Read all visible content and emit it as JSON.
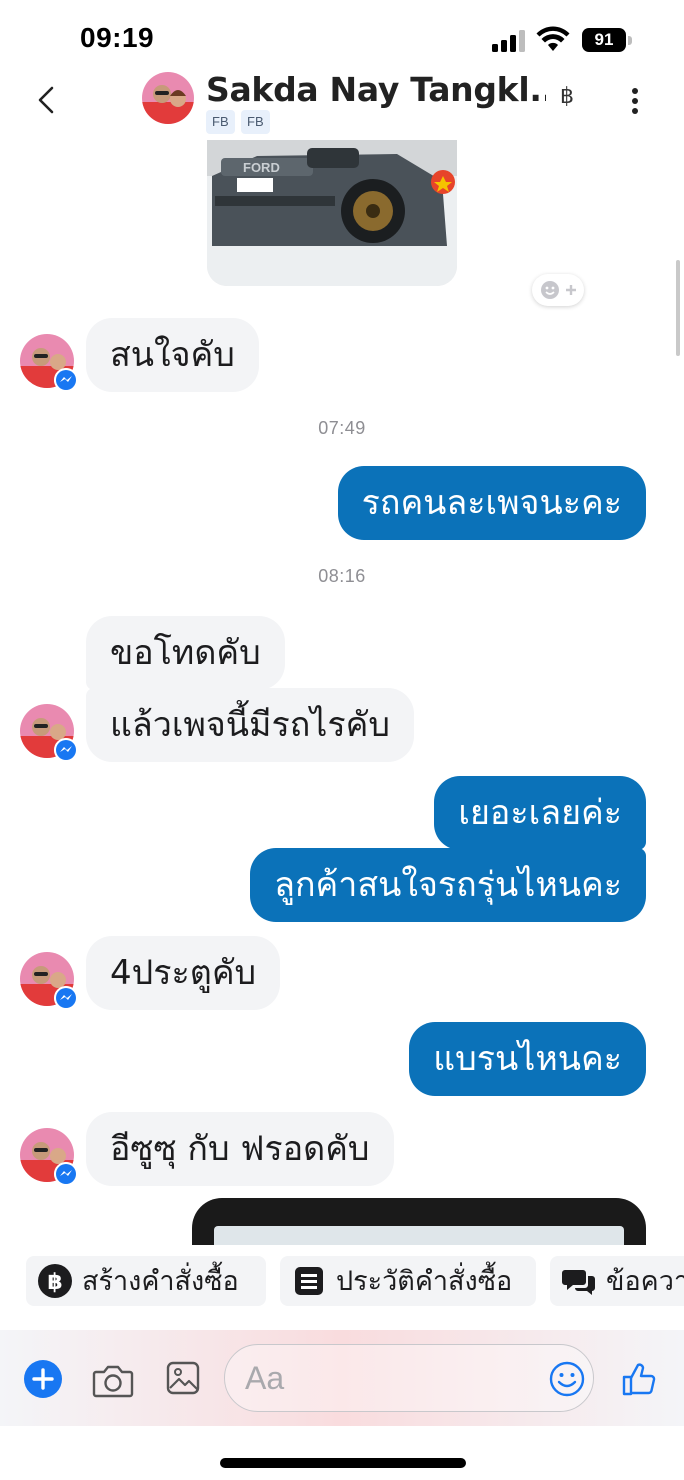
{
  "status_bar": {
    "time": "09:19",
    "battery": "91",
    "icons": [
      "cellular-signal-icon",
      "wifi-icon",
      "battery-icon"
    ]
  },
  "header": {
    "contact_name": "Sakda Nay Tangkl...",
    "source_badges": [
      "FB",
      "FB"
    ],
    "currency_symbol": "฿",
    "icons": [
      "back-chevron-icon",
      "baht-icon",
      "more-vertical-icon"
    ]
  },
  "messages": [
    {
      "type": "image",
      "from": "contact",
      "description": "car-photo"
    },
    {
      "from": "contact",
      "text": "สนใจคับ"
    },
    {
      "type": "timestamp",
      "text": "07:49"
    },
    {
      "from": "me",
      "text": "รถคนละเพจนะคะ"
    },
    {
      "type": "timestamp",
      "text": "08:16"
    },
    {
      "from": "contact",
      "text": "ขอโทดคับ"
    },
    {
      "from": "contact",
      "text": "แล้วเพจนี้มีรถไรคับ"
    },
    {
      "from": "me",
      "text": "เยอะเลยค่ะ"
    },
    {
      "from": "me",
      "text": "ลูกค้าสนใจรถรุ่นไหนคะ"
    },
    {
      "from": "contact",
      "text": "4ประตูคับ"
    },
    {
      "from": "me",
      "text": "แบรนไหนคะ"
    },
    {
      "from": "contact",
      "text": "อีซูซุ กับ ฟรอดคับ"
    },
    {
      "type": "image",
      "from": "contact",
      "description": "phone-screenshot"
    }
  ],
  "quick_actions": [
    {
      "label": "สร้างคำสั่งซื้อ",
      "icon": "baht-circle-icon"
    },
    {
      "label": "ประวัติคำสั่งซื้อ",
      "icon": "list-icon"
    },
    {
      "label": "ข้อควา",
      "icon": "chat-bubbles-icon"
    }
  ],
  "composer": {
    "placeholder": "Aa",
    "icons": [
      "plus-circle-icon",
      "camera-icon",
      "gallery-icon",
      "emoji-icon",
      "thumbs-up-icon"
    ]
  },
  "colors": {
    "outgoing_bubble": "#0b72b9",
    "incoming_bubble": "#f3f4f6",
    "accent_blue": "#1877f2",
    "timestamp_gray": "#8e8e93"
  }
}
